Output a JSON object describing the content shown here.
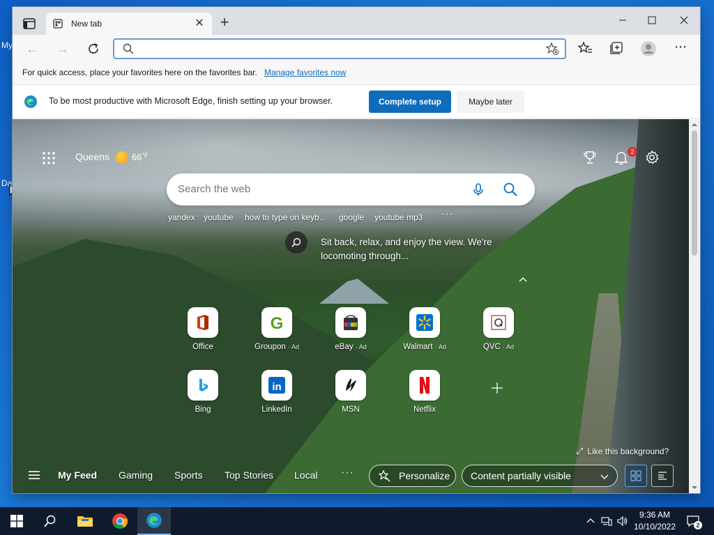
{
  "desktop": {
    "label_top": "My",
    "label_mid": "Da"
  },
  "browser": {
    "tab_title": "New tab",
    "address_placeholder": "",
    "favorites_bar": {
      "text": "For quick access, place your favorites here on the favorites bar.",
      "link": "Manage favorites now"
    },
    "setup_bar": {
      "message": "To be most productive with Microsoft Edge, finish setting up your browser.",
      "complete_label": "Complete setup",
      "later_label": "Maybe later"
    }
  },
  "newtab": {
    "location": "Queens",
    "temperature": "66",
    "temp_unit": "°F",
    "notification_count": "2",
    "search_placeholder": "Search the web",
    "suggestions": [
      "yandex",
      "youtube",
      "how to type on keyb...",
      "google",
      "youtube mp3"
    ],
    "caption": "Sit back, relax, and enjoy the view. We're locomoting through...",
    "tiles": [
      {
        "label": "Office",
        "ad": "",
        "icon": "office-icon",
        "color": "#d83b01"
      },
      {
        "label": "Groupon",
        "ad": "· Ad",
        "icon": "groupon-icon",
        "color": "#53a318"
      },
      {
        "label": "eBay",
        "ad": "· Ad",
        "icon": "ebay-icon",
        "color": "#e53238"
      },
      {
        "label": "Walmart",
        "ad": "· Ad",
        "icon": "walmart-icon",
        "color": "#0071ce"
      },
      {
        "label": "QVC",
        "ad": "· Ad",
        "icon": "qvc-icon",
        "color": "#c4262e"
      },
      {
        "label": "Bing",
        "ad": "",
        "icon": "bing-icon",
        "color": "#1ba1e2"
      },
      {
        "label": "LinkedIn",
        "ad": "",
        "icon": "linkedin-icon",
        "color": "#0a66c2"
      },
      {
        "label": "MSN",
        "ad": "",
        "icon": "msn-icon",
        "color": "#111111"
      },
      {
        "label": "Netflix",
        "ad": "",
        "icon": "netflix-icon",
        "color": "#e50914"
      }
    ],
    "like_background": "Like this background?",
    "feed_tabs": [
      "My Feed",
      "Gaming",
      "Sports",
      "Top Stories",
      "Local"
    ],
    "personalize_label": "Personalize",
    "content_visibility": "Content partially visible"
  },
  "taskbar": {
    "time": "9:36 AM",
    "date": "10/10/2022",
    "notification_count": "2"
  },
  "colors": {
    "accent": "#0f6cbd",
    "taskbar": "#0f1b2d",
    "desktop": "#0e5fc6"
  }
}
